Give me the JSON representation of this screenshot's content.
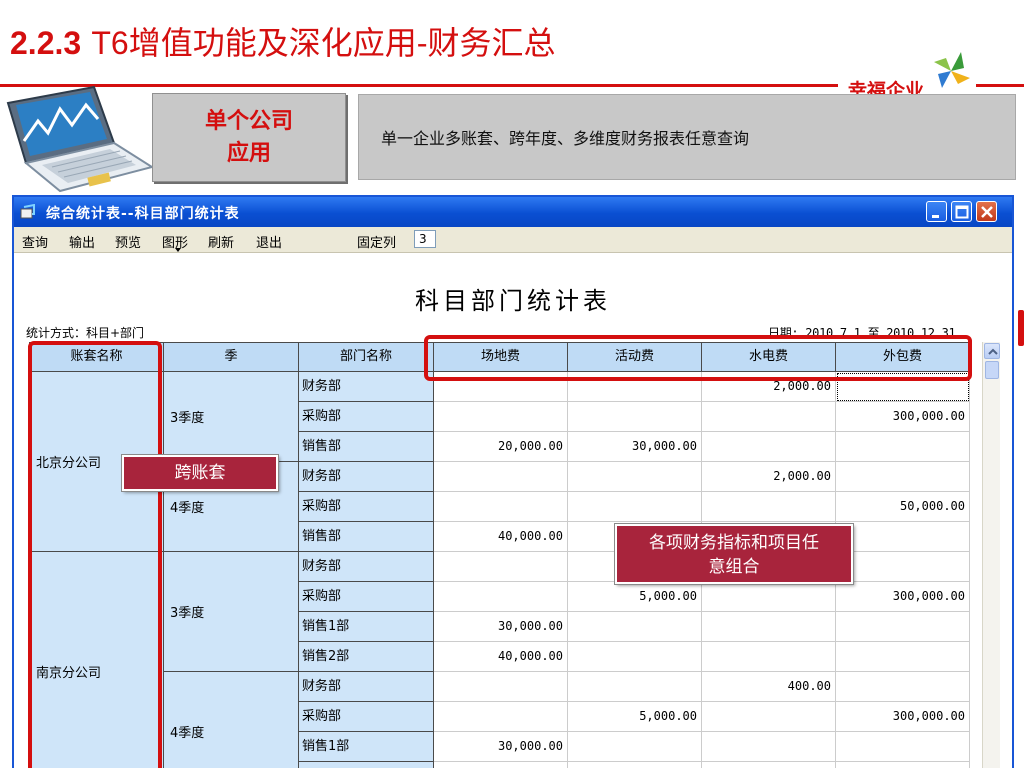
{
  "slide": {
    "title_num": "2.2.3",
    "title_t6": "T6",
    "title_cn": "增值功能及深化应用-财务汇总",
    "logo": "幸福企业",
    "tag_line1": "单个公司",
    "tag_line2": "应用",
    "desc": "单一企业多账套、跨年度、多维度财务报表任意查询"
  },
  "window": {
    "title": "综合统计表--科目部门统计表",
    "menu": [
      "查询",
      "输出",
      "预览",
      "图形",
      "刷新",
      "退出"
    ],
    "frozen_label": "固定列",
    "frozen_value": "3"
  },
  "report": {
    "title": "科目部门统计表",
    "method": "统计方式：科目+部门",
    "date": "日期: 2010.7.1 至 2010.12.31",
    "headers": [
      "账套名称",
      "季",
      "部门名称",
      "场地费",
      "活动费",
      "水电费",
      "外包费"
    ],
    "accounts": [
      "北京分公司",
      "南京分公司"
    ],
    "seasons": [
      "3季度",
      "4季度",
      "3季度",
      "4季度"
    ],
    "rows": [
      {
        "dept": "财务部",
        "v": [
          "",
          "",
          "2,000.00",
          ""
        ]
      },
      {
        "dept": "采购部",
        "v": [
          "",
          "",
          "",
          "300,000.00"
        ]
      },
      {
        "dept": "销售部",
        "v": [
          "20,000.00",
          "30,000.00",
          "",
          ""
        ]
      },
      {
        "dept": "财务部",
        "v": [
          "",
          "",
          "2,000.00",
          ""
        ]
      },
      {
        "dept": "采购部",
        "v": [
          "",
          "",
          "",
          "50,000.00"
        ]
      },
      {
        "dept": "销售部",
        "v": [
          "40,000.00",
          "",
          "",
          ""
        ]
      },
      {
        "dept": "财务部",
        "v": [
          "",
          "",
          "",
          ""
        ]
      },
      {
        "dept": "采购部",
        "v": [
          "",
          "5,000.00",
          "",
          "300,000.00"
        ]
      },
      {
        "dept": "销售1部",
        "v": [
          "30,000.00",
          "",
          "",
          ""
        ]
      },
      {
        "dept": "销售2部",
        "v": [
          "40,000.00",
          "",
          "",
          ""
        ]
      },
      {
        "dept": "财务部",
        "v": [
          "",
          "",
          "400.00",
          ""
        ]
      },
      {
        "dept": "采购部",
        "v": [
          "",
          "5,000.00",
          "",
          "300,000.00"
        ]
      },
      {
        "dept": "销售1部",
        "v": [
          "30,000.00",
          "",
          "",
          ""
        ]
      },
      {
        "dept": "",
        "v": [
          "",
          "",
          "",
          ""
        ]
      }
    ]
  },
  "callouts": {
    "cross": "跨账套",
    "combo_line1": "各项财务指标和项目任",
    "combo_line2": "意组合"
  }
}
